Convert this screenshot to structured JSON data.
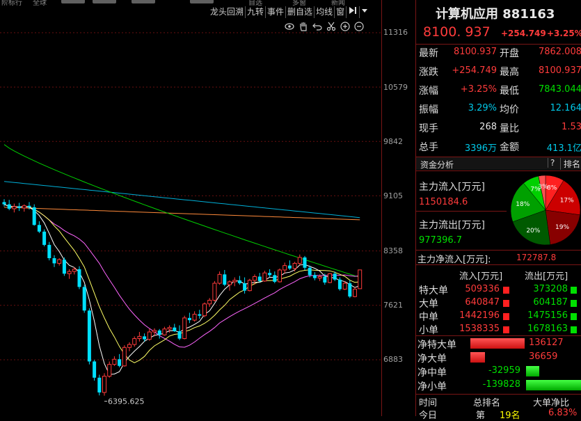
{
  "top_menu": {
    "items": [
      "阶标行",
      "全球",
      "自选",
      "多窗",
      "新闻"
    ]
  },
  "toolbar": {
    "items": [
      "龙头回溯",
      "九转",
      "事件",
      "删自选",
      "均线",
      "窗"
    ],
    "more_icon": "play-next-icon",
    "dropdown_icon": "triangle-down-icon"
  },
  "chart_tools": [
    "eye-icon",
    "hand-icon",
    "undo-icon",
    "scissors-icon",
    "zoom-in-icon",
    "zoom-out-icon"
  ],
  "colors": {
    "up": "#ff3b3b",
    "down": "#00e0ff",
    "ma5": "#ffffff",
    "ma10": "#ffff66",
    "ma20": "#ff66ff",
    "ma60": "#00d000",
    "ma120": "#00b0d8",
    "ma250": "#ff8a3a",
    "border": "#7a1515"
  },
  "chart_data": {
    "type": "candlestick",
    "y_ticks": [
      "11316",
      "10579",
      "9842",
      "9105",
      "8358",
      "7621",
      "6883"
    ],
    "ylim": [
      6500,
      11400
    ],
    "low_label": "6395.625",
    "candles": [
      [
        9020,
        9060,
        8960,
        8990
      ],
      [
        8990,
        9050,
        8910,
        8930
      ],
      [
        8930,
        9000,
        8880,
        8960
      ],
      [
        8960,
        9010,
        8900,
        8940
      ],
      [
        8940,
        8990,
        8890,
        8970
      ],
      [
        8970,
        9020,
        8920,
        8950
      ],
      [
        8950,
        8990,
        8700,
        8710
      ],
      [
        8710,
        8760,
        8600,
        8620
      ],
      [
        8620,
        8650,
        8420,
        8440
      ],
      [
        8440,
        8480,
        8230,
        8260
      ],
      [
        8260,
        8300,
        8140,
        8190
      ],
      [
        8190,
        8260,
        8160,
        8240
      ],
      [
        8240,
        8270,
        8020,
        8050
      ],
      [
        8050,
        8110,
        7980,
        8080
      ],
      [
        8080,
        8140,
        8040,
        8110
      ],
      [
        8110,
        8150,
        7840,
        7870
      ],
      [
        7870,
        7900,
        7520,
        7550
      ],
      [
        7550,
        7580,
        6820,
        6860
      ],
      [
        6860,
        6880,
        6600,
        6640
      ],
      [
        6640,
        6680,
        6400,
        6440
      ],
      [
        6440,
        6700,
        6396,
        6660
      ],
      [
        6660,
        6860,
        6640,
        6820
      ],
      [
        6820,
        6930,
        6800,
        6890
      ],
      [
        6890,
        6960,
        6780,
        6800
      ],
      [
        6800,
        7080,
        6790,
        7050
      ],
      [
        7050,
        7120,
        7000,
        7090
      ],
      [
        7090,
        7200,
        7060,
        7170
      ],
      [
        7170,
        7260,
        7130,
        7200
      ],
      [
        7200,
        7240,
        7130,
        7160
      ],
      [
        7160,
        7300,
        7140,
        7260
      ],
      [
        7260,
        7310,
        7200,
        7280
      ],
      [
        7280,
        7300,
        7170,
        7220
      ],
      [
        7220,
        7330,
        7210,
        7300
      ],
      [
        7300,
        7350,
        7250,
        7320
      ],
      [
        7320,
        7370,
        7260,
        7270
      ],
      [
        7270,
        7350,
        7150,
        7170
      ],
      [
        7170,
        7480,
        7160,
        7450
      ],
      [
        7450,
        7520,
        7380,
        7420
      ],
      [
        7420,
        7540,
        7400,
        7500
      ],
      [
        7500,
        7560,
        7440,
        7480
      ],
      [
        7480,
        7660,
        7460,
        7640
      ],
      [
        7640,
        7720,
        7600,
        7690
      ],
      [
        7690,
        7950,
        7670,
        7920
      ],
      [
        7920,
        8080,
        7900,
        8040
      ],
      [
        8040,
        8100,
        7880,
        7900
      ],
      [
        7900,
        7960,
        7820,
        7940
      ],
      [
        7940,
        8000,
        7880,
        7960
      ],
      [
        7960,
        8020,
        7900,
        7920
      ],
      [
        7920,
        8000,
        7780,
        7820
      ],
      [
        7820,
        7980,
        7810,
        7960
      ],
      [
        7960,
        8040,
        7900,
        8010
      ],
      [
        8010,
        8060,
        7930,
        7950
      ],
      [
        7950,
        8090,
        7940,
        8060
      ],
      [
        8060,
        8110,
        8000,
        8030
      ],
      [
        8030,
        8080,
        7920,
        7940
      ],
      [
        7940,
        8120,
        7930,
        8100
      ],
      [
        8100,
        8200,
        8050,
        8160
      ],
      [
        8160,
        8230,
        8100,
        8120
      ],
      [
        8120,
        8210,
        8080,
        8190
      ],
      [
        8190,
        8310,
        8170,
        8270
      ],
      [
        8270,
        8290,
        8100,
        8130
      ],
      [
        8130,
        8160,
        8000,
        8030
      ],
      [
        8030,
        8070,
        7960,
        7990
      ],
      [
        7990,
        8040,
        7950,
        8010
      ],
      [
        8010,
        8050,
        7900,
        7930
      ],
      [
        7930,
        8060,
        7920,
        8050
      ],
      [
        8050,
        8080,
        7950,
        7970
      ],
      [
        7970,
        8000,
        7820,
        7840
      ],
      [
        7840,
        7950,
        7830,
        7920
      ],
      [
        7920,
        7960,
        7720,
        7740
      ],
      [
        7740,
        7870,
        7730,
        7840
      ],
      [
        7846,
        8101,
        7843,
        8101
      ]
    ]
  },
  "stock": {
    "name": "计算机应用",
    "code": "881163",
    "price": "8100. 937",
    "change": "+254.749",
    "change_pct": "+3.25%"
  },
  "quote": [
    {
      "l1": "最新",
      "v1": "8100.937",
      "c1": "red",
      "l2": "开盘",
      "v2": "7862.008",
      "c2": "red"
    },
    {
      "l1": "涨跌",
      "v1": "+254.749",
      "c1": "red",
      "l2": "最高",
      "v2": "8100.937",
      "c2": "red"
    },
    {
      "l1": "涨幅",
      "v1": "+3.25%",
      "c1": "red",
      "l2": "最低",
      "v2": "7843.044",
      "c2": "green"
    },
    {
      "l1": "振幅",
      "v1": "3.29%",
      "c1": "cyan",
      "l2": "均价",
      "v2": "12.164",
      "c2": "cyan"
    },
    {
      "l1": "现手",
      "v1": "268",
      "c1": "white",
      "l2": "量比",
      "v2": "1.53",
      "c2": "red"
    },
    {
      "l1": "总手",
      "v1": "3396万",
      "c1": "cyan",
      "l2": "金额",
      "v2": "413.1亿",
      "c2": "cyan"
    }
  ],
  "fund": {
    "title": "资金分析",
    "q_label": "?",
    "rank_label": "排名",
    "inflow_label": "主力流入[万元]",
    "inflow_value": "1150184.6",
    "outflow_label": "主力流出[万元]",
    "outflow_value": "977396.7",
    "net_label": "主力净流入[万元]:",
    "net_value": "172787.8",
    "pie": [
      {
        "label": "8%",
        "value": 8,
        "color": "#ff2020"
      },
      {
        "label": "17%",
        "value": 17,
        "color": "#cc0000"
      },
      {
        "label": "19%",
        "value": 19,
        "color": "#880000"
      },
      {
        "label": "20%",
        "value": 20,
        "color": "#005a00"
      },
      {
        "label": "18%",
        "value": 18,
        "color": "#00a000"
      },
      {
        "label": "7%",
        "value": 7,
        "color": "#00d000"
      },
      {
        "label": "3%",
        "value": 3,
        "color": "#ff5050"
      }
    ]
  },
  "flow_table": {
    "headers": [
      "流入[万元]",
      "流出[万元]"
    ],
    "rows": [
      {
        "label": "特大单",
        "in": "509336",
        "out": "373208"
      },
      {
        "label": "大单",
        "in": "640847",
        "out": "604187"
      },
      {
        "label": "中单",
        "in": "1442196",
        "out": "1475156"
      },
      {
        "label": "小单",
        "in": "1538335",
        "out": "1678163"
      }
    ]
  },
  "net_table": [
    {
      "label": "净特大单",
      "value": "136127",
      "amount": 136127,
      "sign": "up"
    },
    {
      "label": "净大单",
      "value": "36659",
      "amount": 36659,
      "sign": "up"
    },
    {
      "label": "净中单",
      "value": "-32959",
      "amount": -32959,
      "sign": "down"
    },
    {
      "label": "净小单",
      "value": "-139828",
      "amount": -139828,
      "sign": "down"
    }
  ],
  "bottom": {
    "headers": [
      "时间",
      "总排名",
      "大单净比"
    ],
    "row": [
      "今日",
      "第",
      "19名",
      "6.83%"
    ]
  }
}
